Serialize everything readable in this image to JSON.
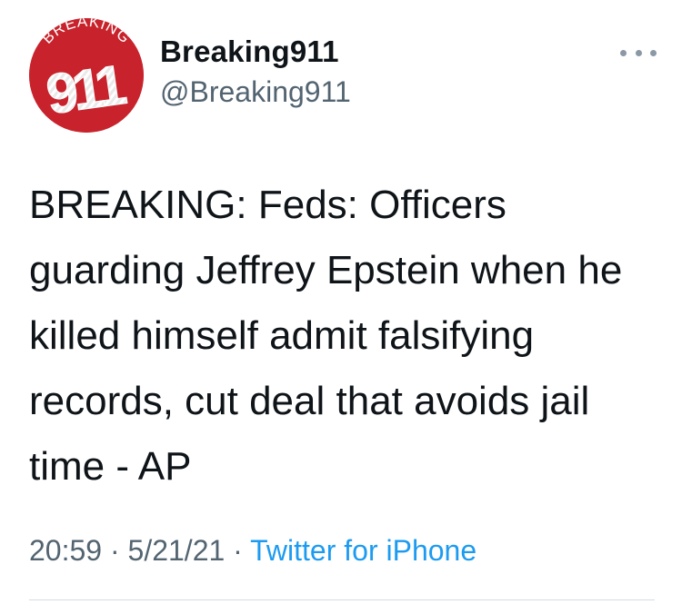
{
  "account": {
    "avatar_text_top": "BREAKING",
    "avatar_text_number": "911",
    "display_name": "Breaking911",
    "handle": "@Breaking911",
    "avatar_color": "#c8232c"
  },
  "tweet": {
    "text": "BREAKING: Feds: Officers guarding Jeffrey Epstein when he killed himself admit falsifying records, cut deal that avoids jail time - AP",
    "time": "20:59",
    "separator": "·",
    "date": "5/21/21",
    "source": "Twitter for iPhone"
  },
  "icons": {
    "more": "more-options-icon"
  },
  "colors": {
    "text": "#0f1419",
    "secondary": "#536471",
    "link": "#1d9bf0"
  }
}
